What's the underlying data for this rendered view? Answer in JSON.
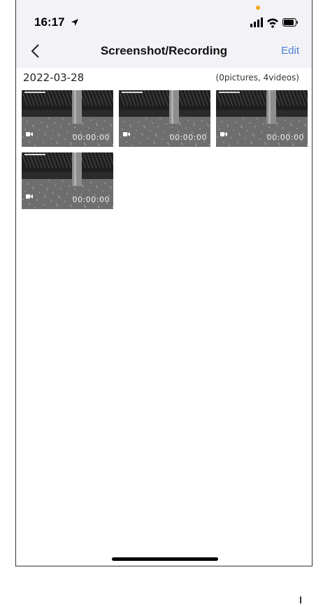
{
  "status_bar": {
    "time": "16:17"
  },
  "nav": {
    "title": "Screenshot/Recording",
    "edit_label": "Edit"
  },
  "group": {
    "date": "2022-03-28",
    "count": "(0pictures, 4videos)",
    "items": [
      {
        "duration": "00:00:00",
        "type": "video"
      },
      {
        "duration": "00:00:00",
        "type": "video"
      },
      {
        "duration": "00:00:00",
        "type": "video"
      },
      {
        "duration": "00:00:00",
        "type": "video"
      }
    ]
  },
  "colors": {
    "accent": "#4a7fd4",
    "header_bg": "#f2f2f7"
  }
}
